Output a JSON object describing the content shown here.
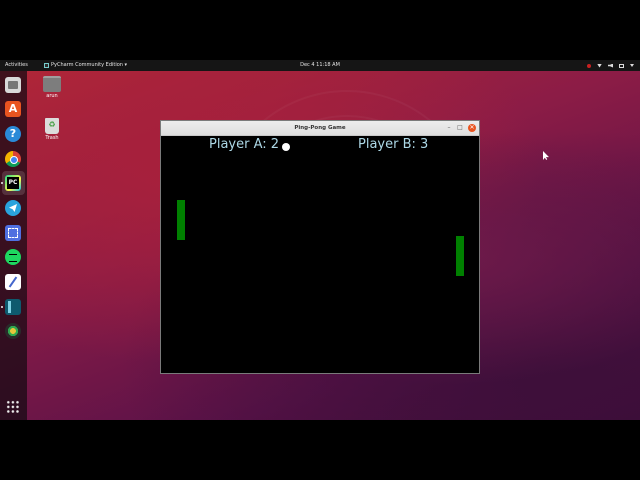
{
  "topbar": {
    "activities": "Activities",
    "app_name": "PyCharm Community Edition ▾",
    "clock": "Dec 4  11:18 AM",
    "tray_icons": [
      "record-indicator",
      "network-icon",
      "volume-icon",
      "battery-icon",
      "menu-caret"
    ]
  },
  "dock": {
    "items": [
      "files",
      "ubuntu-software",
      "help",
      "chrome",
      "pycharm",
      "telegram",
      "screenshot",
      "spotify",
      "text-editor",
      "ide",
      "camera"
    ],
    "show_apps": "apps-grid"
  },
  "desktop": {
    "icons": [
      {
        "label": "arun",
        "icon": "home-folder-icon"
      },
      {
        "label": "Trash",
        "icon": "trash-icon"
      }
    ]
  },
  "window": {
    "title": "Ping-Pong Game",
    "buttons": {
      "minimize": "–",
      "maximize": "□",
      "close": "✕"
    }
  },
  "game": {
    "score_a_text": "Player A: 2",
    "score_b_text": "Player B: 3",
    "score_a": 2,
    "score_b": 3,
    "colors": {
      "background": "#000000",
      "score": "#add8e6",
      "paddle": "#008000",
      "ball": "#ffffff"
    }
  }
}
